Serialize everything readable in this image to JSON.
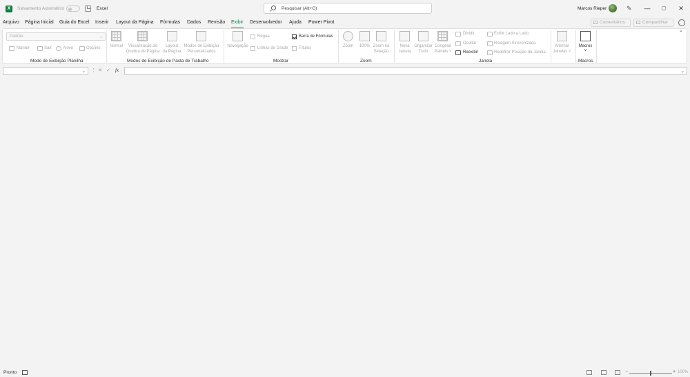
{
  "titlebar": {
    "autosave_label": "Salvamento Automático",
    "app_name": "Excel",
    "search_placeholder": "Pesquisar (Alt+G)",
    "user_name": "Marcos Rieper",
    "minimize": "—",
    "restore": "□",
    "close": "✕"
  },
  "menu": {
    "items": [
      "Arquivo",
      "Página Inicial",
      "Guia do Excel",
      "Inserir",
      "Layout da Página",
      "Fórmulas",
      "Dados",
      "Revisão",
      "Exibir",
      "Desenvolvedor",
      "Ajuda",
      "Power Pivot"
    ],
    "active": "Exibir",
    "comments": "Comentários",
    "share": "Compartilhar"
  },
  "ribbon": {
    "sheet_view": {
      "dropdown_value": "Padrão",
      "manter": "Manter",
      "sair": "Sair",
      "novo": "Novo",
      "opcoes": "Opções",
      "label": "Modo de Exibição Planilha"
    },
    "workbook_views": {
      "normal": "Normal",
      "page_break_1": "Visualização da",
      "page_break_2": "Quebra de Página",
      "page_layout_1": "Layout",
      "page_layout_2": "da Página",
      "custom_1": "Modos de Exibição",
      "custom_2": "Personalizados",
      "label": "Modos de Exibição de Pasta de Trabalho"
    },
    "show": {
      "navigation": "Navegação",
      "ruler": "Régua",
      "gridlines": "Linhas de Grade",
      "formula_bar": "Barra de Fórmulas",
      "headings": "Títulos",
      "label": "Mostrar"
    },
    "zoom": {
      "zoom": "Zoom",
      "hundred": "100%",
      "zoom_sel_1": "Zoom na",
      "zoom_sel_2": "Seleção",
      "label": "Zoom"
    },
    "window": {
      "new_1": "Nova",
      "new_2": "Janela",
      "arrange_1": "Organizar",
      "arrange_2": "Tudo",
      "freeze_1": "Congelar",
      "freeze_2": "Painéis ˅",
      "split": "Dividir",
      "hide": "Ocultar",
      "unhide": "Reexibir",
      "side_by_side": "Exibir Lado a Lado",
      "sync_scroll": "Rolagem Sincronizada",
      "reset_pos": "Redefinir Posição da Janela",
      "switch_1": "Alternar",
      "switch_2": "Janelas ˅",
      "label": "Janela"
    },
    "macros": {
      "macros": "Macros",
      "caret": "˅",
      "label": "Macros"
    }
  },
  "formula_bar": {
    "name_box": "",
    "separator": "⋮",
    "cancel": "✕",
    "enter": "✓",
    "fx": "fx",
    "formula": ""
  },
  "status": {
    "ready": "Pronto",
    "zoom_pct": "100%",
    "zoom_level": 0.5
  }
}
